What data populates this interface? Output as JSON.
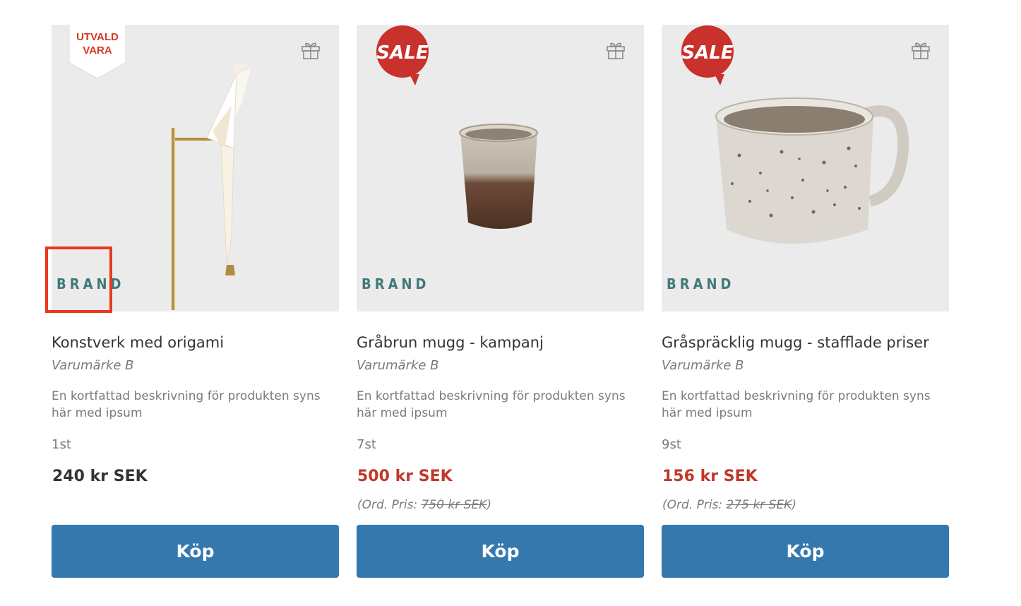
{
  "products": [
    {
      "badge_lines": [
        "UTVALD",
        "VARA"
      ],
      "brand_logo": "BRAND",
      "title": "Konstverk med origami",
      "vendor": "Varumärke B",
      "description": "En kortfattad beskrivning för produkten syns här med ipsum",
      "stock": "1st",
      "price": "240 kr SEK",
      "buy_label": "Köp"
    },
    {
      "badge": "SALE",
      "brand_logo": "BRAND",
      "title": "Gråbrun mugg - kampanj",
      "vendor": "Varumärke B",
      "description": "En kortfattad beskrivning för produkten syns här med ipsum",
      "stock": "7st",
      "price": "500 kr SEK",
      "ord_prefix": "(Ord. Pris: ",
      "ord_price": "750 kr SEK",
      "ord_suffix": ")",
      "buy_label": "Köp"
    },
    {
      "badge": "SALE",
      "brand_logo": "BRAND",
      "title": "Gråspräcklig mugg - stafflade priser",
      "vendor": "Varumärke B",
      "description": "En kortfattad beskrivning för produkten syns här med ipsum",
      "stock": "9st",
      "price": "156 kr SEK",
      "ord_prefix": "(Ord. Pris: ",
      "ord_price": "275 kr SEK",
      "ord_suffix": ")",
      "buy_label": "Köp"
    }
  ],
  "colors": {
    "buy_button": "#3478ae",
    "sale_price": "#c0392b",
    "sale_badge": "#c8312c",
    "brand_logo": "#3f7a78",
    "highlight_box": "#e8391f"
  },
  "icons": [
    "gift-icon",
    "sale-badge",
    "featured-badge"
  ]
}
